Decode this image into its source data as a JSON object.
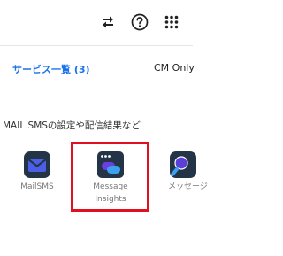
{
  "header": {
    "icons": [
      "swap-arrows-icon",
      "help-icon",
      "apps-grid-icon"
    ]
  },
  "tabs": [
    {
      "label": "サービス一覧 (3)",
      "active": true
    },
    {
      "label": "CM Only",
      "active": false
    }
  ],
  "section": {
    "description": "MAIL SMSの設定や配信結果など"
  },
  "apps": [
    {
      "label_lines": [
        "MailSMS"
      ],
      "icon": "mail-envelope-icon"
    },
    {
      "label_lines": [
        "Message",
        "Insights"
      ],
      "icon": "message-insights-icon",
      "highlighted": true
    },
    {
      "label_lines": [
        "メッセージ"
      ],
      "icon": "message-search-icon"
    }
  ],
  "colors": {
    "accent": "#1a73e8",
    "highlight": "#e01020",
    "icon_dark": "#243447"
  }
}
